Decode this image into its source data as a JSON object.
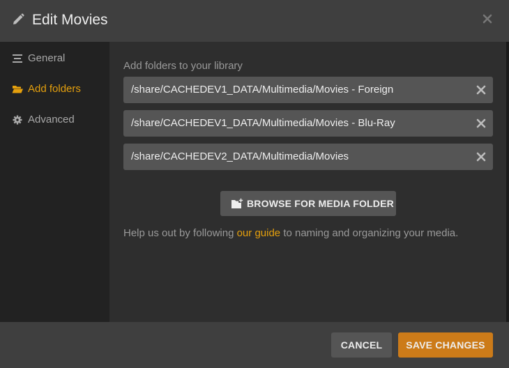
{
  "dialog": {
    "title": "Edit Movies",
    "icons": {
      "title": "pencil-icon",
      "close": "close-icon"
    }
  },
  "sidebar": {
    "items": [
      {
        "label": "General",
        "icon": "list-icon",
        "active": false
      },
      {
        "label": "Add folders",
        "icon": "folder-open-icon",
        "active": true
      },
      {
        "label": "Advanced",
        "icon": "gear-icon",
        "active": false
      }
    ]
  },
  "main": {
    "section_label": "Add folders to your library",
    "folders": [
      "/share/CACHEDEV1_DATA/Multimedia/Movies - Foreign",
      "/share/CACHEDEV1_DATA/Multimedia/Movies - Blu-Ray",
      "/share/CACHEDEV2_DATA/Multimedia/Movies"
    ],
    "browse_label": "BROWSE FOR MEDIA FOLDER",
    "help": {
      "before": "Help us out by following ",
      "link": "our guide",
      "after": " to naming and organizing your media."
    }
  },
  "footer": {
    "cancel_label": "CANCEL",
    "save_label": "SAVE CHANGES"
  },
  "colors": {
    "accent": "#e5a00d",
    "save_button": "#cc7b19",
    "header_bg": "#3f3f3f",
    "sidebar_bg": "#222222",
    "content_bg": "#2e2e2e",
    "field_bg": "#555555"
  }
}
